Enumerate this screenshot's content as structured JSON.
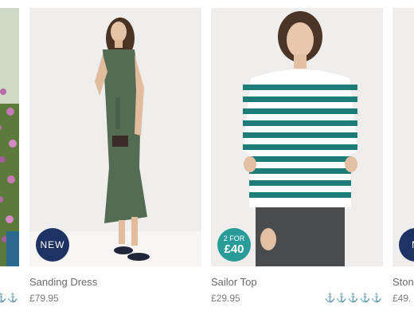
{
  "colors": {
    "new_badge": "#1e3364",
    "offer_badge": "#2a9c98",
    "rating_stars": "#d63b6e",
    "dress_green": "#546c54",
    "stripe_teal": "#1d7c77"
  },
  "products": [
    {
      "name": "",
      "price": "",
      "rating_glyphs": "⚓⚓⚓",
      "image_icon": "flower-garden-photo"
    },
    {
      "name": "Sanding Dress",
      "price": "£79.95",
      "badge": "NEW",
      "image_icon": "green-dress-photo"
    },
    {
      "name": "Sailor Top",
      "price": "£29.95",
      "rating_glyphs": "⚓⚓⚓⚓⚓",
      "badge_line1": "2 FOR",
      "badge_line2": "£40",
      "image_icon": "striped-top-photo"
    },
    {
      "name": "Ston",
      "price": "£49.",
      "badge": "N",
      "image_icon": "model-photo"
    }
  ]
}
